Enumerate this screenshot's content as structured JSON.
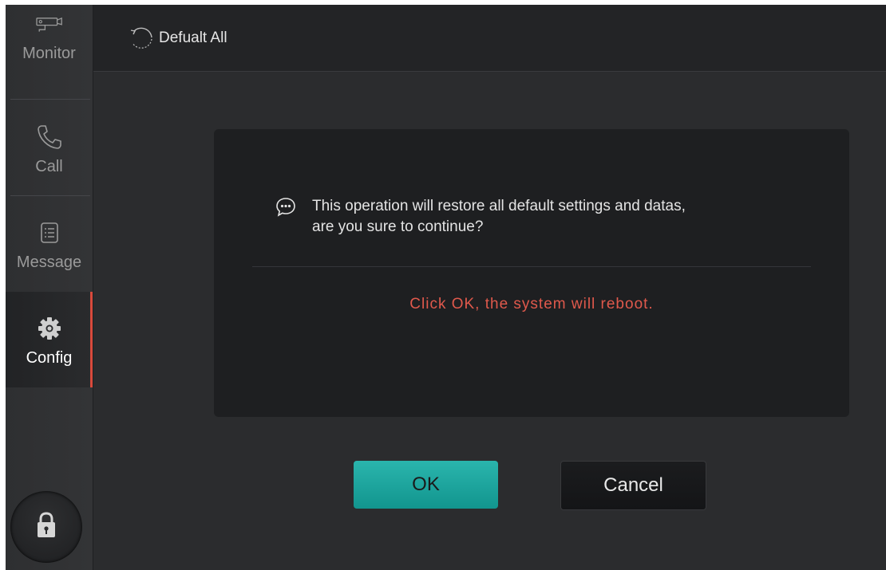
{
  "sidebar": {
    "items": [
      {
        "label": "Monitor",
        "icon": "camera-icon",
        "active": false
      },
      {
        "label": "Call",
        "icon": "phone-icon",
        "active": false
      },
      {
        "label": "Message",
        "icon": "message-list-icon",
        "active": false
      },
      {
        "label": "Config",
        "icon": "gear-icon",
        "active": true
      }
    ],
    "lock_icon": "lock-icon"
  },
  "header": {
    "icon": "restore-icon",
    "title": "Defualt All"
  },
  "dialog": {
    "icon": "chat-bubble-icon",
    "message_line1": "This operation will restore all default settings and datas,",
    "message_line2": "are you sure to continue?",
    "warning": "Click OK, the system will reboot."
  },
  "buttons": {
    "ok_label": "OK",
    "cancel_label": "Cancel"
  },
  "colors": {
    "accent_teal": "#1aa59d",
    "warning_red": "#e0594c",
    "active_marker": "#d84a3c"
  }
}
